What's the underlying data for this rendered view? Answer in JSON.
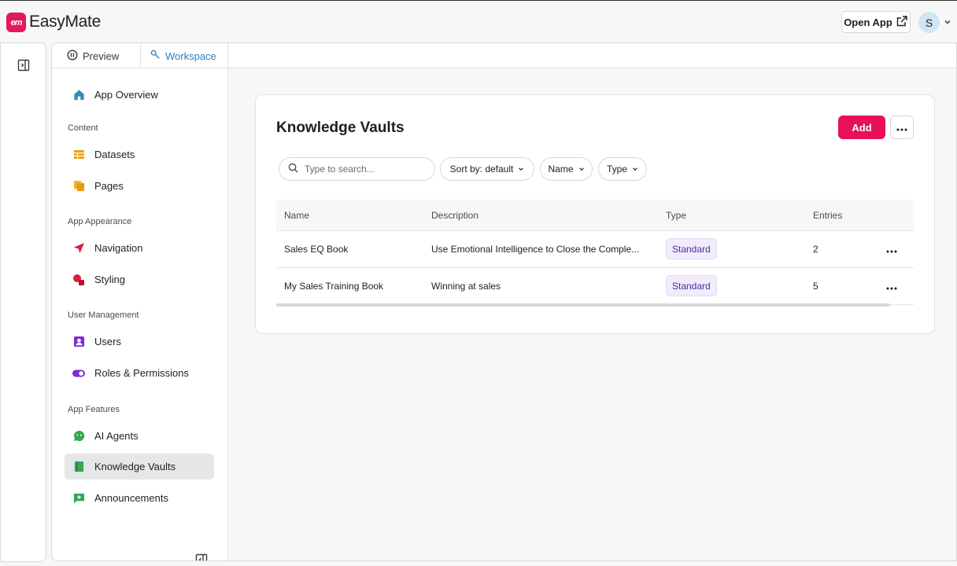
{
  "app": {
    "logo_mark": "em",
    "name": "EasyMate"
  },
  "header": {
    "open_app_label": "Open App",
    "avatar_initial": "S"
  },
  "tabs": {
    "preview": "Preview",
    "workspace": "Workspace"
  },
  "sidebar": {
    "overview": "App Overview",
    "content_label": "Content",
    "datasets": "Datasets",
    "pages": "Pages",
    "appearance_label": "App Appearance",
    "navigation": "Navigation",
    "styling": "Styling",
    "user_mgmt_label": "User Management",
    "users": "Users",
    "roles": "Roles & Permissions",
    "features_label": "App Features",
    "ai_agents": "AI Agents",
    "knowledge_vaults": "Knowledge Vaults",
    "announcements": "Announcements"
  },
  "main": {
    "title": "Knowledge Vaults",
    "add_label": "Add",
    "search_placeholder": "Type to search...",
    "sort_label": "Sort by: default",
    "name_filter": "Name",
    "type_filter": "Type",
    "columns": {
      "name": "Name",
      "description": "Description",
      "type": "Type",
      "entries": "Entries"
    },
    "rows": [
      {
        "name": "Sales EQ Book",
        "description": "Use Emotional Intelligence to Close the Comple...",
        "type": "Standard",
        "entries": "2"
      },
      {
        "name": "My Sales Training Book",
        "description": "Winning at sales",
        "type": "Standard",
        "entries": "5"
      }
    ]
  },
  "colors": {
    "brand": "#e8105b",
    "link": "#2d7fc2",
    "badge_text": "#4b2ea3"
  },
  "icons": {
    "home": "home-icon",
    "datasets": "table-icon",
    "pages": "pages-icon",
    "navigation": "send-arrow-icon",
    "styling": "palette-icon",
    "users": "user-icon",
    "roles": "toggle-icon",
    "ai": "chat-bot-icon",
    "vault": "book-icon",
    "announce": "star-message-icon"
  }
}
